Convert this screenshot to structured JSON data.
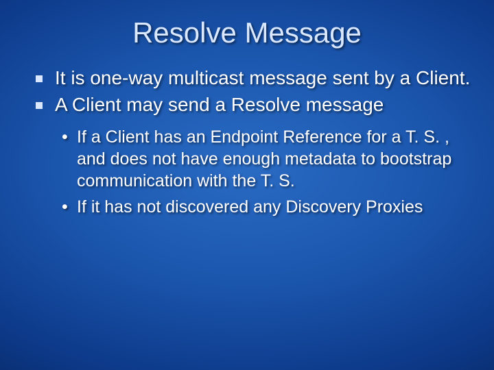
{
  "title": "Resolve Message",
  "bullets": [
    "It is one-way multicast message sent by a Client.",
    "A Client may send a Resolve message"
  ],
  "subbullets": [
    "If a Client has an Endpoint Reference for a T. S. , and does not have enough metadata to bootstrap communication with the T. S.",
    "If it has not discovered any Discovery Proxies"
  ]
}
